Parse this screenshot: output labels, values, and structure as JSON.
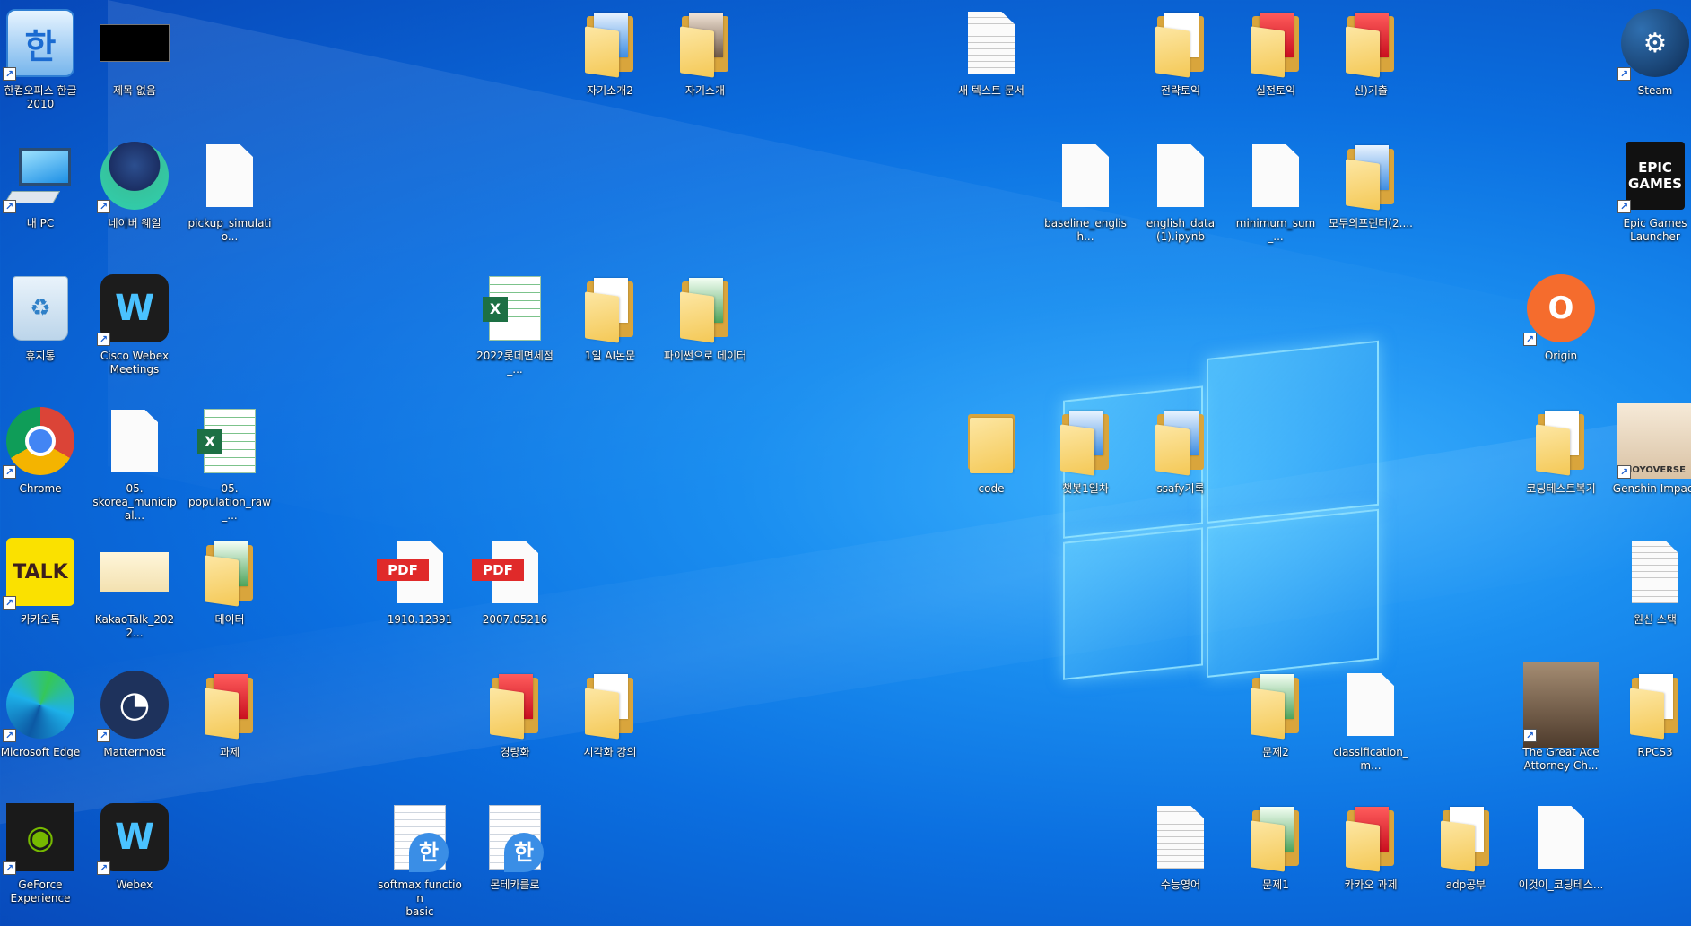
{
  "desktop": {
    "icons": {
      "hancom": {
        "label": "한컴오피스 한글\n2010",
        "glyph": "한"
      },
      "untitled": {
        "label": "제목 없음"
      },
      "mypc": {
        "label": "내 PC"
      },
      "whale": {
        "label": "네이버 웨일"
      },
      "pickup": {
        "label": "pickup_simulatio..."
      },
      "recycle": {
        "label": "휴지통",
        "glyph": "♻"
      },
      "webex_meetings": {
        "label": "Cisco Webex\nMeetings",
        "glyph": "W"
      },
      "chrome": {
        "label": "Chrome"
      },
      "skorea": {
        "label": "05.\nskorea_municipal..."
      },
      "population": {
        "label": "05.\npopulation_raw_..."
      },
      "kakaotalk": {
        "label": "카카오톡",
        "glyph": "TALK"
      },
      "kakao_img": {
        "label": "KakaoTalk_2022..."
      },
      "data_folder": {
        "label": "데이터"
      },
      "edge": {
        "label": "Microsoft Edge"
      },
      "mattermost": {
        "label": "Mattermost",
        "glyph": "◔"
      },
      "homework": {
        "label": "과제"
      },
      "geforce": {
        "label": "GeForce\nExperience",
        "glyph": "◉"
      },
      "webex": {
        "label": "Webex",
        "glyph": "W"
      },
      "selfintro2": {
        "label": "자기소개2"
      },
      "selfintro": {
        "label": "자기소개"
      },
      "lotte": {
        "label": "2022롯데면세점_..."
      },
      "ai_paper": {
        "label": "1일 AI논문"
      },
      "python_data": {
        "label": "파이썬으로 데이터"
      },
      "pdf1": {
        "label": "1910.12391",
        "glyph": "PDF"
      },
      "pdf2": {
        "label": "2007.05216",
        "glyph": "PDF"
      },
      "kyungyang": {
        "label": "경량화"
      },
      "visual": {
        "label": "시각화 강의"
      },
      "softmax": {
        "label": "softmax function\nbasic",
        "glyph": "한"
      },
      "montecarlo": {
        "label": "몬테카를로",
        "glyph": "한"
      },
      "newtext": {
        "label": "새 텍스트 문서"
      },
      "code": {
        "label": "code"
      },
      "chatbot": {
        "label": "챗봇1일차"
      },
      "ssafy": {
        "label": "ssafy기록"
      },
      "strategy_toeic": {
        "label": "전략토익"
      },
      "practice_toeic": {
        "label": "실전토익"
      },
      "new_exam": {
        "label": "신)기출"
      },
      "baseline": {
        "label": "baseline_english..."
      },
      "english_data": {
        "label": "english_data\n(1).ipynb"
      },
      "minimum": {
        "label": "minimum_sum_..."
      },
      "printer": {
        "label": "모두의프린터(2...."
      },
      "problem2": {
        "label": "문제2"
      },
      "classification": {
        "label": "classification_m..."
      },
      "suneung": {
        "label": "수능영어"
      },
      "problem1": {
        "label": "문제1"
      },
      "kakao_task": {
        "label": "카카오 과제"
      },
      "adp": {
        "label": "adp공부"
      },
      "this_coding": {
        "label": "이것이_코딩테스..."
      },
      "steam": {
        "label": "Steam",
        "glyph": "⚙"
      },
      "epic": {
        "label": "Epic Games\nLauncher",
        "glyph": "EPIC\nGAMES"
      },
      "origin": {
        "label": "Origin",
        "glyph": "O"
      },
      "coding_review": {
        "label": "코딩테스트복기"
      },
      "genshin": {
        "label": "Genshin Impact",
        "glyph": "HOYOVERSE"
      },
      "wonsin": {
        "label": "원신 스택"
      },
      "ace_attorney": {
        "label": "The Great Ace\nAttorney Ch..."
      },
      "rpcs3": {
        "label": "RPCS3"
      }
    }
  }
}
